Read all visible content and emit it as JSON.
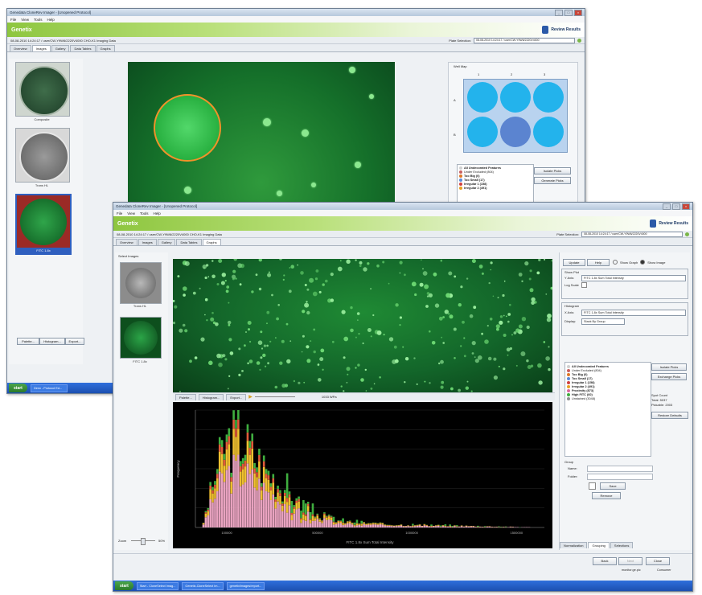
{
  "back_window": {
    "title": "Genedata CloneRev Imager - [Unopened Protocol]",
    "menu": [
      "File",
      "View",
      "Tools",
      "Help"
    ],
    "banner_title": "Genetix",
    "review_results": "Review Results",
    "info_left": "08-08-2010 14:24:17 / user/CW-Y9W6/2220V4000 CHO-K1 Imaging Data",
    "plate_selection_label": "Plate Selection:",
    "plate_selection_value": "08-08-2010 14:24:17 / user/CW-Y9W6/2220V4000",
    "tabs": [
      "Overview",
      "Images",
      "Gallery",
      "Data Tables",
      "Graphs"
    ],
    "active_tab": 1,
    "thumbnails": [
      {
        "label": "Composite"
      },
      {
        "label": "Trans HL"
      },
      {
        "label": "FITC 1.8x"
      }
    ],
    "well_map": {
      "title": "Well Map",
      "cols": [
        "1",
        "2",
        "3"
      ],
      "rows": [
        "A",
        "B"
      ],
      "well_color": "#23b3ec",
      "selected_well_color": "#5b84d0"
    },
    "legend": [
      {
        "label": "All Undecorated Features",
        "color": "#d0d0d0"
      },
      {
        "label": "Under Excluded (804)",
        "color": "#c86060"
      },
      {
        "label": "Too Big (0)",
        "color": "#e07828"
      },
      {
        "label": "Too Small (17)",
        "color": "#5a8ad8"
      },
      {
        "label": "Irregular 1 (158)",
        "color": "#d04040"
      },
      {
        "label": "Irregular 2 (491)",
        "color": "#e8a020"
      }
    ],
    "side_buttons": [
      "Isolate Picks",
      "Generate Picks"
    ],
    "bottom_toolbar": [
      "Palette...",
      "Histogram...",
      "Export..."
    ],
    "taskbar": {
      "start": "start",
      "items": [
        "Genx - Protocol Ed..."
      ]
    }
  },
  "front_window": {
    "title": "Genedata CloneRev Imager - [Unopened Protocol]",
    "menu": [
      "File",
      "View",
      "Tools",
      "Help"
    ],
    "banner_title": "Genetix",
    "review_results": "Review Results",
    "info_left": "08-08-2010 14:24:17 / user/CW-Y9W6/2220V4000 CHO-K1 Imaging Data",
    "plate_selection_label": "Plate Selection:",
    "plate_selection_value": "08-08-2010 14:24:17 / user/CW-Y9W6/2220V4000",
    "tabs": [
      "Overview",
      "Images",
      "Gallery",
      "Data Tables",
      "Graphs"
    ],
    "active_tab": 4,
    "thumbnails_title": "Select Images",
    "thumbnails": [
      {
        "label": "Trans HL"
      },
      {
        "label": "FITC 1.8x"
      }
    ],
    "zoom_label": "Zoom",
    "zoom_value": "50%",
    "image_toolbar": [
      "Palette...",
      "Histogram...",
      "Export..."
    ],
    "image_zoom_readout": "1033 WPa",
    "right_panel": {
      "buttons_top": [
        "Update",
        "Help"
      ],
      "show_graph": "Show Graph",
      "show_image": "Show Image",
      "show_box_title": "Show Plot",
      "y_axis_label": "Y Axis:",
      "y_axis_value": "FITC 1.8x Sum Total Intensity",
      "log_scale_label": "Log Scale",
      "histogram_title": "Histogram",
      "x_axis_label": "X Axis:",
      "x_axis_value": "FITC 1.8x Sum Total Intensity",
      "display_label": "Display:",
      "display_value": "Stack By Group",
      "legend": [
        {
          "label": "All Undecorated Features",
          "color": "#d0d0d0"
        },
        {
          "label": "Under Excluded (804)",
          "color": "#c86060"
        },
        {
          "label": "Too Big (0)",
          "color": "#e07828"
        },
        {
          "label": "Too Small (17)",
          "color": "#5a8ad8"
        },
        {
          "label": "Irregular 1 (158)",
          "color": "#d04040"
        },
        {
          "label": "Irregular 2 (491)",
          "color": "#e8a020"
        },
        {
          "label": "Proximity (873)",
          "color": "#d86aa0"
        },
        {
          "label": "High FITC (60)",
          "color": "#3fae3f"
        },
        {
          "label": "Unstained (3048)",
          "color": "#909090"
        }
      ],
      "side_buttons": [
        "Isolate Picks",
        "Exchange Picks"
      ],
      "spot_count": "Spot Count",
      "total": "Total: 5037",
      "pickable": "Pickable: 2003",
      "restore_defaults": "Restore Defaults",
      "group_label": "Group",
      "name_label": "Name:",
      "folder_label": "Folder:",
      "save_btn": "Save",
      "remove_btn": "Remove",
      "bottom_tabs": [
        "Normalization",
        "Grouping",
        "Selections"
      ]
    },
    "footer_buttons": [
      "Back",
      "Next",
      "Close"
    ],
    "footer_status": "monitor.ge.pic",
    "footer_status2": "Consumer",
    "taskbar": {
      "start": "start",
      "items": [
        "Start - CloneSelect Imag...",
        "Genetix-CloneSelect Im...",
        "genetix/images/report..."
      ]
    }
  },
  "chart_data": {
    "type": "bar",
    "stacked": true,
    "xlabel": "FITC 1.8x Sum Total Intensity",
    "ylabel": "Frequency",
    "xtick_labels": [
      "100000",
      "500000",
      "1000000",
      "1500000"
    ],
    "series": [
      {
        "name": "Proximity (873)",
        "color": "#e9a3c0"
      },
      {
        "name": "Irregular 2 (491)",
        "color": "#f0c030"
      },
      {
        "name": "Irregular 1 (158)",
        "color": "#e05a3a"
      },
      {
        "name": "High FITC (60)",
        "color": "#3fae3f"
      }
    ],
    "bins": 150,
    "envelope": [
      {
        "x": 0.02,
        "y": 0.05
      },
      {
        "x": 0.05,
        "y": 0.45
      },
      {
        "x": 0.08,
        "y": 0.78
      },
      {
        "x": 0.12,
        "y": 0.88
      },
      {
        "x": 0.16,
        "y": 0.72
      },
      {
        "x": 0.2,
        "y": 0.55
      },
      {
        "x": 0.25,
        "y": 0.38
      },
      {
        "x": 0.3,
        "y": 0.22
      },
      {
        "x": 0.35,
        "y": 0.12
      },
      {
        "x": 0.42,
        "y": 0.06
      },
      {
        "x": 0.55,
        "y": 0.03
      },
      {
        "x": 0.8,
        "y": 0.015
      },
      {
        "x": 1.0,
        "y": 0.0
      }
    ]
  }
}
